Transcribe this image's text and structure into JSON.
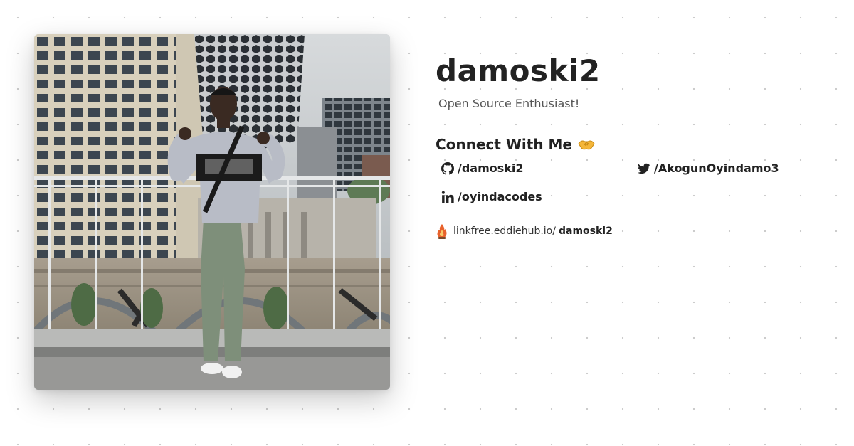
{
  "profile": {
    "username": "damoski2",
    "bio": "Open Source Enthusiast!",
    "photo_alt": "Profile photo"
  },
  "connect": {
    "heading": "Connect With Me",
    "emoji_icon": "handshake-icon"
  },
  "socials": [
    {
      "icon": "github-icon",
      "label": "/damoski2"
    },
    {
      "icon": "twitter-icon",
      "label": "/AkogunOyindamo3"
    },
    {
      "icon": "linkedin-icon",
      "label": "/oyindacodes"
    }
  ],
  "footer": {
    "icon": "linkfree-flame-icon",
    "prefix": "linkfree.eddiehub.io/",
    "name": "damoski2"
  },
  "colors": {
    "text": "#222222",
    "muted": "#555555",
    "dots": "#c9c9c9",
    "accent_flame": "#e8622c"
  }
}
